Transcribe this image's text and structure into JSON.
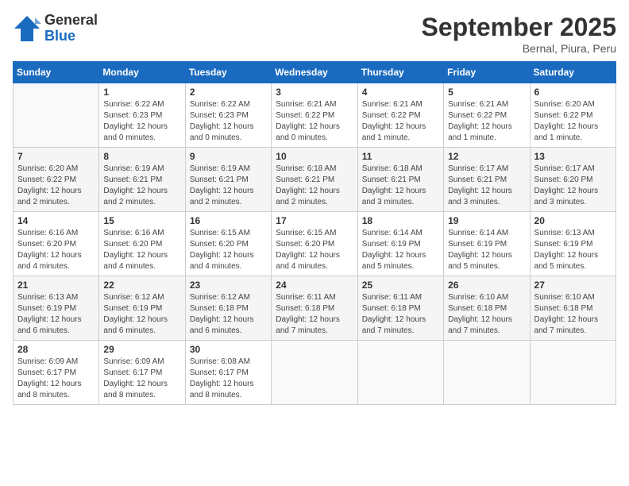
{
  "logo": {
    "line1": "General",
    "line2": "Blue"
  },
  "title": "September 2025",
  "location": "Bernal, Piura, Peru",
  "days_of_week": [
    "Sunday",
    "Monday",
    "Tuesday",
    "Wednesday",
    "Thursday",
    "Friday",
    "Saturday"
  ],
  "weeks": [
    [
      {
        "day": "",
        "info": ""
      },
      {
        "day": "1",
        "info": "Sunrise: 6:22 AM\nSunset: 6:23 PM\nDaylight: 12 hours\nand 0 minutes."
      },
      {
        "day": "2",
        "info": "Sunrise: 6:22 AM\nSunset: 6:23 PM\nDaylight: 12 hours\nand 0 minutes."
      },
      {
        "day": "3",
        "info": "Sunrise: 6:21 AM\nSunset: 6:22 PM\nDaylight: 12 hours\nand 0 minutes."
      },
      {
        "day": "4",
        "info": "Sunrise: 6:21 AM\nSunset: 6:22 PM\nDaylight: 12 hours\nand 1 minute."
      },
      {
        "day": "5",
        "info": "Sunrise: 6:21 AM\nSunset: 6:22 PM\nDaylight: 12 hours\nand 1 minute."
      },
      {
        "day": "6",
        "info": "Sunrise: 6:20 AM\nSunset: 6:22 PM\nDaylight: 12 hours\nand 1 minute."
      }
    ],
    [
      {
        "day": "7",
        "info": "Sunrise: 6:20 AM\nSunset: 6:22 PM\nDaylight: 12 hours\nand 2 minutes."
      },
      {
        "day": "8",
        "info": "Sunrise: 6:19 AM\nSunset: 6:21 PM\nDaylight: 12 hours\nand 2 minutes."
      },
      {
        "day": "9",
        "info": "Sunrise: 6:19 AM\nSunset: 6:21 PM\nDaylight: 12 hours\nand 2 minutes."
      },
      {
        "day": "10",
        "info": "Sunrise: 6:18 AM\nSunset: 6:21 PM\nDaylight: 12 hours\nand 2 minutes."
      },
      {
        "day": "11",
        "info": "Sunrise: 6:18 AM\nSunset: 6:21 PM\nDaylight: 12 hours\nand 3 minutes."
      },
      {
        "day": "12",
        "info": "Sunrise: 6:17 AM\nSunset: 6:21 PM\nDaylight: 12 hours\nand 3 minutes."
      },
      {
        "day": "13",
        "info": "Sunrise: 6:17 AM\nSunset: 6:20 PM\nDaylight: 12 hours\nand 3 minutes."
      }
    ],
    [
      {
        "day": "14",
        "info": "Sunrise: 6:16 AM\nSunset: 6:20 PM\nDaylight: 12 hours\nand 4 minutes."
      },
      {
        "day": "15",
        "info": "Sunrise: 6:16 AM\nSunset: 6:20 PM\nDaylight: 12 hours\nand 4 minutes."
      },
      {
        "day": "16",
        "info": "Sunrise: 6:15 AM\nSunset: 6:20 PM\nDaylight: 12 hours\nand 4 minutes."
      },
      {
        "day": "17",
        "info": "Sunrise: 6:15 AM\nSunset: 6:20 PM\nDaylight: 12 hours\nand 4 minutes."
      },
      {
        "day": "18",
        "info": "Sunrise: 6:14 AM\nSunset: 6:19 PM\nDaylight: 12 hours\nand 5 minutes."
      },
      {
        "day": "19",
        "info": "Sunrise: 6:14 AM\nSunset: 6:19 PM\nDaylight: 12 hours\nand 5 minutes."
      },
      {
        "day": "20",
        "info": "Sunrise: 6:13 AM\nSunset: 6:19 PM\nDaylight: 12 hours\nand 5 minutes."
      }
    ],
    [
      {
        "day": "21",
        "info": "Sunrise: 6:13 AM\nSunset: 6:19 PM\nDaylight: 12 hours\nand 6 minutes."
      },
      {
        "day": "22",
        "info": "Sunrise: 6:12 AM\nSunset: 6:19 PM\nDaylight: 12 hours\nand 6 minutes."
      },
      {
        "day": "23",
        "info": "Sunrise: 6:12 AM\nSunset: 6:18 PM\nDaylight: 12 hours\nand 6 minutes."
      },
      {
        "day": "24",
        "info": "Sunrise: 6:11 AM\nSunset: 6:18 PM\nDaylight: 12 hours\nand 7 minutes."
      },
      {
        "day": "25",
        "info": "Sunrise: 6:11 AM\nSunset: 6:18 PM\nDaylight: 12 hours\nand 7 minutes."
      },
      {
        "day": "26",
        "info": "Sunrise: 6:10 AM\nSunset: 6:18 PM\nDaylight: 12 hours\nand 7 minutes."
      },
      {
        "day": "27",
        "info": "Sunrise: 6:10 AM\nSunset: 6:18 PM\nDaylight: 12 hours\nand 7 minutes."
      }
    ],
    [
      {
        "day": "28",
        "info": "Sunrise: 6:09 AM\nSunset: 6:17 PM\nDaylight: 12 hours\nand 8 minutes."
      },
      {
        "day": "29",
        "info": "Sunrise: 6:09 AM\nSunset: 6:17 PM\nDaylight: 12 hours\nand 8 minutes."
      },
      {
        "day": "30",
        "info": "Sunrise: 6:08 AM\nSunset: 6:17 PM\nDaylight: 12 hours\nand 8 minutes."
      },
      {
        "day": "",
        "info": ""
      },
      {
        "day": "",
        "info": ""
      },
      {
        "day": "",
        "info": ""
      },
      {
        "day": "",
        "info": ""
      }
    ]
  ]
}
